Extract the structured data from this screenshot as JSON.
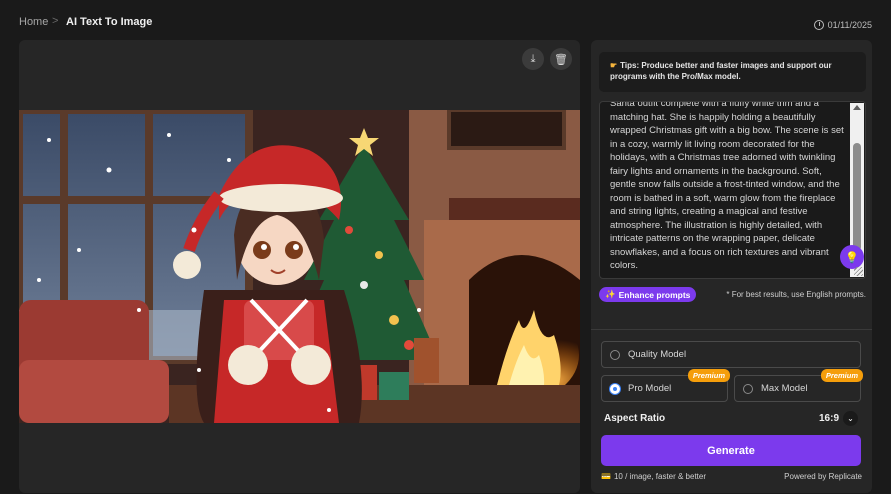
{
  "breadcrumb": {
    "home": "Home",
    "separator": ">",
    "current": "AI Text To Image"
  },
  "date": "01/11/2025",
  "preview": {
    "download_icon": "download-icon",
    "delete_icon": "trash-icon",
    "image_alt": "Anime girl in red Santa outfit holding a gift beside a Christmas tree and fireplace"
  },
  "tips": {
    "icon": "pointing-hand-icon",
    "text": "Tips: Produce better and faster images and support our programs with the Pro/Max model."
  },
  "prompt": {
    "value": "Santa outfit complete with a fluffy white trim and a matching hat. She is happily holding a beautifully wrapped Christmas gift with a big bow. The scene is set in a cozy, warmly lit living room decorated for the holidays, with a Christmas tree adorned with twinkling fairy lights and ornaments in the background. Soft, gentle snow falls outside a frost-tinted window, and the room is bathed in a soft, warm glow from the fireplace and string lights, creating a magical and festive atmosphere. The illustration is highly detailed, with intricate patterns on the wrapping paper, delicate snowflakes, and a focus on rich textures and vibrant colors."
  },
  "enhance_label": "Enhance prompts",
  "hint": "* For best results, use English prompts.",
  "models": {
    "quality": "Quality Model",
    "pro": "Pro Model",
    "max": "Max Model",
    "premium_badge": "Premium"
  },
  "aspect": {
    "label": "Aspect Ratio",
    "value": "16:9"
  },
  "generate_label": "Generate",
  "cost": "10 / image, faster & better",
  "powered_by": "Powered by Replicate",
  "colors": {
    "accent": "#7c3aed",
    "premium": "#f59e0b",
    "radio_selected": "#3b82f6"
  }
}
